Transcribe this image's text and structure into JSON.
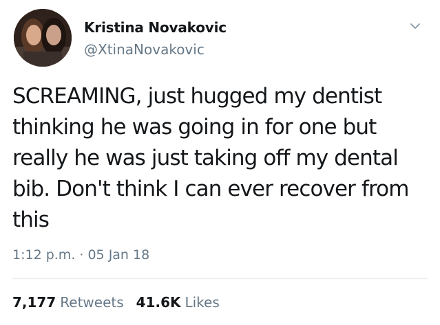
{
  "author": {
    "display_name": "Kristina Novakovic",
    "handle": "@XtinaNovakovic"
  },
  "tweet": {
    "text": "SCREAMING, just hugged my dentist thinking he was going in for one but really he was just taking off my dental bib. Don't think I can ever recover from this",
    "timestamp": "1:12 p.m. · 05 Jan 18"
  },
  "stats": {
    "retweets_count": "7,177",
    "retweets_label": "Retweets",
    "likes_count": "41.6K",
    "likes_label": "Likes"
  },
  "colors": {
    "text_primary": "#14171a",
    "text_secondary": "#657786",
    "divider": "#e6ecf0"
  },
  "icons": {
    "menu": "chevron-down-icon"
  }
}
